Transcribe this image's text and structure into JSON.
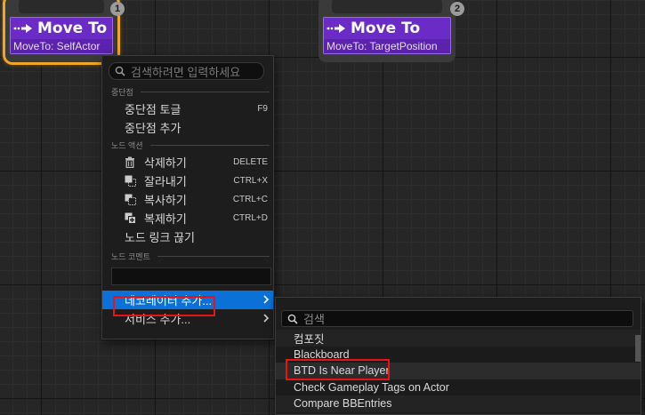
{
  "nodes": [
    {
      "title": "Move To",
      "subtitle": "MoveTo: SelfActor",
      "order": "1",
      "selected": true
    },
    {
      "title": "Move To",
      "subtitle": "MoveTo: TargetPosition",
      "order": "2",
      "selected": false
    }
  ],
  "context_menu": {
    "search_placeholder": "검색하려면 입력하세요",
    "sections": {
      "breakpoint": "중단점",
      "node_actions": "노드 액션",
      "node_comment": "노드 코멘트"
    },
    "breakpoint_items": [
      {
        "label": "중단점 토글",
        "shortcut": "F9"
      },
      {
        "label": "중단점 추가",
        "shortcut": ""
      }
    ],
    "action_items": [
      {
        "label": "삭제하기",
        "shortcut": "DELETE",
        "icon": "trash-icon"
      },
      {
        "label": "잘라내기",
        "shortcut": "CTRL+X",
        "icon": "cut-icon"
      },
      {
        "label": "복사하기",
        "shortcut": "CTRL+C",
        "icon": "copy-icon"
      },
      {
        "label": "복제하기",
        "shortcut": "CTRL+D",
        "icon": "duplicate-icon"
      },
      {
        "label": "노드 링크 끊기",
        "shortcut": "",
        "icon": ""
      }
    ],
    "comment_value": "",
    "add_decorator": "데코레이터 추가...",
    "add_service": "서비스 추가..."
  },
  "decorator_menu": {
    "search_placeholder": "검색",
    "items": [
      "컴포짓",
      "Blackboard",
      "BTD Is Near Player",
      "Check Gameplay Tags on Actor",
      "Compare BBEntries"
    ],
    "highlighted_item": "BTD Is Near Player"
  },
  "colors": {
    "node_purple": "#6a2bc6",
    "selection_orange": "#f0a622",
    "menu_highlight": "#0b70d8",
    "annotation_red": "#e11111"
  }
}
